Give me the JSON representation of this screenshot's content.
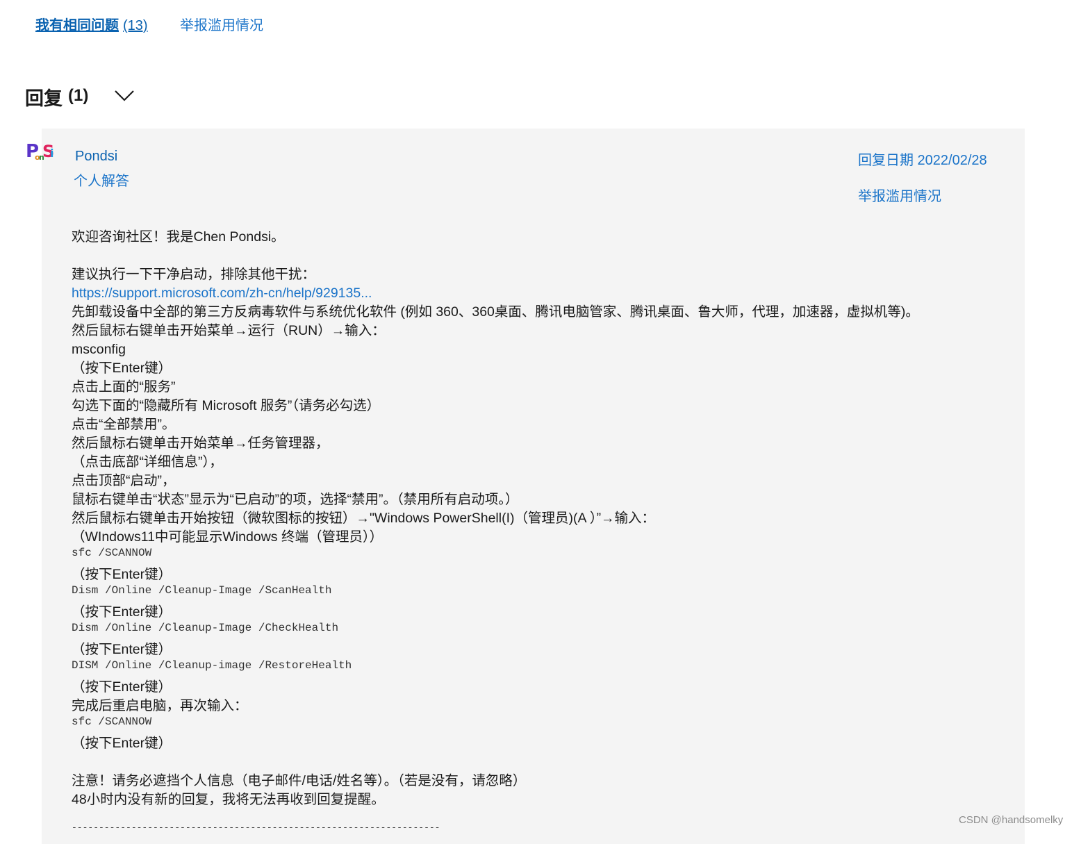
{
  "top_links": {
    "same_question_label": "我有相同问题",
    "same_question_count": "(13)",
    "report_label": "举报滥用情况"
  },
  "replies": {
    "title": "回复",
    "count": "(1)"
  },
  "reply": {
    "author": "Pondsi",
    "role": "个人解答",
    "date": "回复日期 2022/02/28",
    "report_label": "举报滥用情况",
    "avatar_text": "PonSi",
    "lines": [
      "欢迎咨询社区！我是Chen Pondsi。",
      "建议执行一下干净启动，排除其他干扰：",
      "https://support.microsoft.com/zh-cn/help/929135...",
      "先卸载设备中全部的第三方反病毒软件与系统优化软件 (例如 360、360桌面、腾讯电脑管家、腾讯桌面、鲁大师，代理，加速器，虚拟机等)。",
      "然后鼠标右键单击开始菜单→运行（RUN）→输入：",
      "msconfig",
      "（按下Enter键）",
      "点击上面的“服务”",
      "勾选下面的“隐藏所有 Microsoft 服务”（请务必勾选）",
      "点击“全部禁用”。",
      "然后鼠标右键单击开始菜单→任务管理器，",
      "（点击底部“详细信息”），",
      "点击顶部“启动”，",
      "鼠标右键单击“状态”显示为“已启动”的项，选择“禁用”。（禁用所有启动项。）",
      "然后鼠标右键单击开始按钮（微软图标的按钮）→\"Windows PowerShell(I)（管理员)(A ）”→输入：",
      "（WIndows11中可能显示Windows 终端（管理员））",
      "sfc /SCANNOW",
      "（按下Enter键）",
      "Dism /Online /Cleanup-Image /ScanHealth",
      "（按下Enter键）",
      "Dism /Online /Cleanup-Image /CheckHealth",
      "（按下Enter键）",
      "DISM /Online /Cleanup-image /RestoreHealth",
      "（按下Enter键）",
      "完成后重启电脑，再次输入：",
      "sfc /SCANNOW",
      "（按下Enter键）",
      "注意！请务必遮挡个人信息（电子邮件/电话/姓名等）。（若是没有，请忽略）",
      "48小时内没有新的回复，我将无法再收到回复提醒。",
      "--------------------------------------------------------------------"
    ]
  },
  "watermark": "CSDN @handsomelky",
  "icons": {
    "expand": "chevron-down-icon",
    "avatar": "user-avatar"
  },
  "colors": {
    "link": "#1b74c9",
    "link_strong": "#0a62b0",
    "card_bg": "#f4f4f4"
  }
}
